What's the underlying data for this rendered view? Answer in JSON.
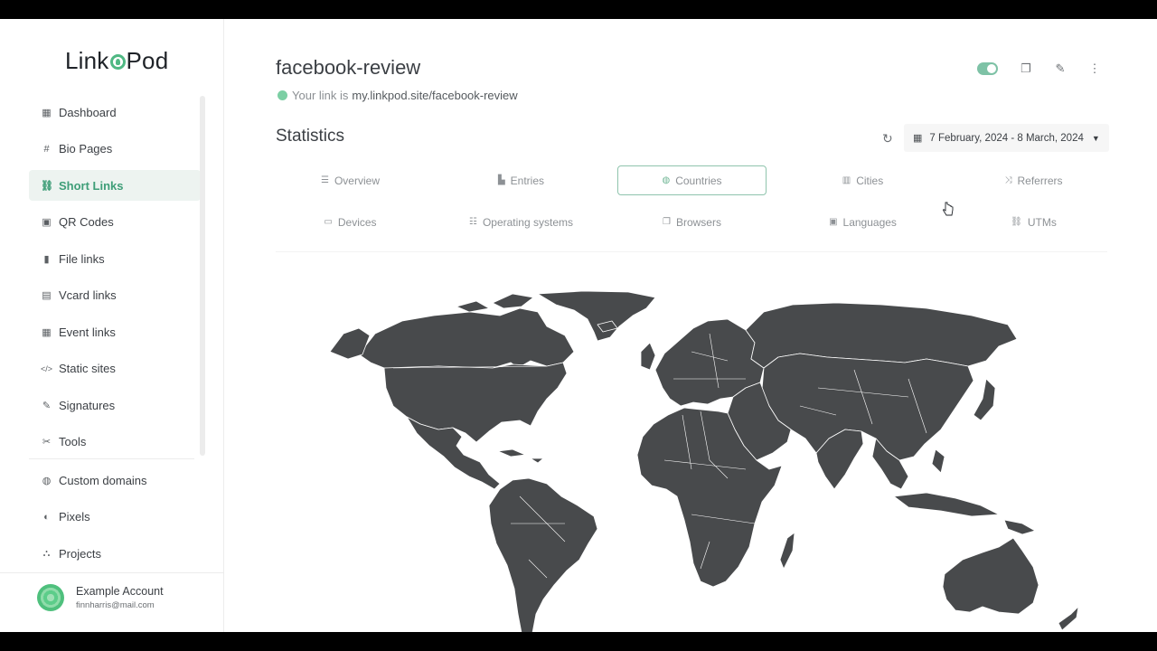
{
  "brand": {
    "name_prefix": "Link",
    "name_o": "",
    "name_suffix": "Pod"
  },
  "sidebar": {
    "items": [
      {
        "label": "Dashboard",
        "icon": "table-icon",
        "glyph": "▦"
      },
      {
        "label": "Bio Pages",
        "icon": "hash-icon",
        "glyph": "#"
      },
      {
        "label": "Short Links",
        "icon": "link-icon",
        "glyph": "⛓",
        "active": true
      },
      {
        "label": "QR Codes",
        "icon": "qrcode-icon",
        "glyph": "▣"
      },
      {
        "label": "File links",
        "icon": "file-icon",
        "glyph": "▮"
      },
      {
        "label": "Vcard links",
        "icon": "id-card-icon",
        "glyph": "▤"
      },
      {
        "label": "Event links",
        "icon": "calendar-icon",
        "glyph": "▦"
      },
      {
        "label": "Static sites",
        "icon": "code-icon",
        "glyph": "</>"
      },
      {
        "label": "Signatures",
        "icon": "signature-icon",
        "glyph": "✎"
      },
      {
        "label": "Tools",
        "icon": "tools-icon",
        "glyph": "✂"
      }
    ],
    "items2": [
      {
        "label": "Custom domains",
        "icon": "globe-icon",
        "glyph": "◍"
      },
      {
        "label": "Pixels",
        "icon": "adjust-icon",
        "glyph": "◐"
      },
      {
        "label": "Projects",
        "icon": "project-diagram-icon",
        "glyph": "⛬"
      }
    ]
  },
  "account": {
    "name": "Example Account",
    "email": "finnharris@mail.com"
  },
  "header": {
    "title": "facebook-review",
    "link_prefix": "Your link is",
    "link_url": "my.linkpod.site/facebook-review"
  },
  "stats": {
    "title": "Statistics",
    "date_range": "7 February, 2024 - 8 March, 2024"
  },
  "tabs": [
    {
      "label": "Overview",
      "icon": "list-icon",
      "glyph": "☰"
    },
    {
      "label": "Entries",
      "icon": "chart-bar-icon",
      "glyph": "▙"
    },
    {
      "label": "Countries",
      "icon": "globe-icon",
      "glyph": "◍",
      "active": true
    },
    {
      "label": "Cities",
      "icon": "city-icon",
      "glyph": "▥"
    },
    {
      "label": "Referrers",
      "icon": "random-icon",
      "glyph": "⤨"
    },
    {
      "label": "Devices",
      "icon": "laptop-icon",
      "glyph": "▭"
    },
    {
      "label": "Operating systems",
      "icon": "server-icon",
      "glyph": "☷"
    },
    {
      "label": "Browsers",
      "icon": "window-restore-icon",
      "glyph": "❐"
    },
    {
      "label": "Languages",
      "icon": "language-icon",
      "glyph": "▣"
    },
    {
      "label": "UTMs",
      "icon": "link-icon",
      "glyph": "⛓"
    }
  ],
  "colors": {
    "accent": "#3f9e78",
    "map_land": "#484a4c",
    "active_bg": "#edf3f0"
  }
}
